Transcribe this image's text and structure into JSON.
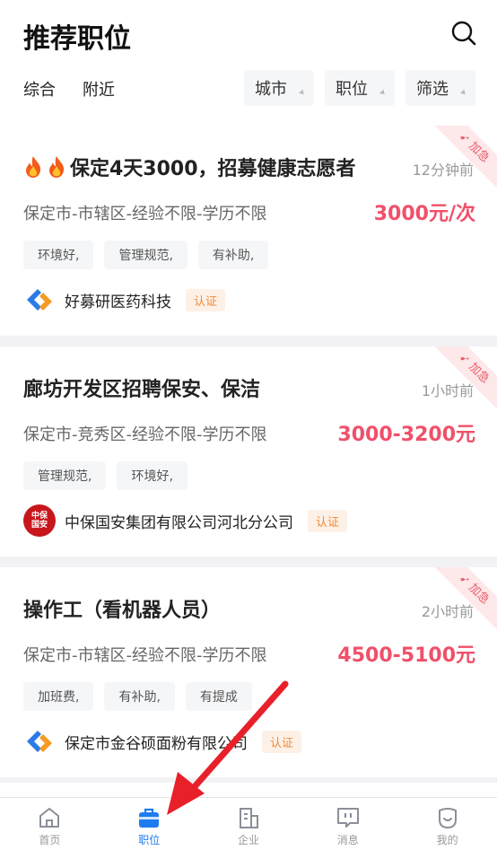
{
  "header": {
    "title": "推荐职位",
    "tabs": [
      "综合",
      "附近"
    ],
    "filters": [
      "城市",
      "职位",
      "筛选"
    ]
  },
  "ribbon_text": "加急",
  "jobs": [
    {
      "title": "保定4天3000，招募健康志愿者",
      "time": "12分钟前",
      "meta": "保定市-市辖区-经验不限-学历不限",
      "salary": "3000元/次",
      "tags": [
        "环境好,",
        "管理规范,",
        "有补助,"
      ],
      "company": "好募研医药科技",
      "badge": "认证"
    },
    {
      "title": "廊坊开发区招聘保安、保洁",
      "time": "1小时前",
      "meta": "保定市-竞秀区-经验不限-学历不限",
      "salary": "3000-3200元",
      "tags": [
        "管理规范,",
        "环境好,"
      ],
      "company": "中保国安集团有限公司河北分公司",
      "badge": "认证"
    },
    {
      "title": "操作工（看机器人员）",
      "time": "2小时前",
      "meta": "保定市-市辖区-经验不限-学历不限",
      "salary": "4500-5100元",
      "tags": [
        "加班费,",
        "有补助,",
        "有提成"
      ],
      "company": "保定市金谷硕面粉有限公司",
      "badge": "认证"
    }
  ],
  "logo_text": "中保国安",
  "tabbar": [
    {
      "label": "首页",
      "icon": "home-icon"
    },
    {
      "label": "职位",
      "icon": "briefcase-icon"
    },
    {
      "label": "企业",
      "icon": "building-icon"
    },
    {
      "label": "消息",
      "icon": "message-icon"
    },
    {
      "label": "我的",
      "icon": "profile-icon"
    }
  ],
  "colors": {
    "accent": "#1e7cf0",
    "salary": "#f0506a",
    "badge": "#f08a3c",
    "arrow": "#e8202a"
  }
}
